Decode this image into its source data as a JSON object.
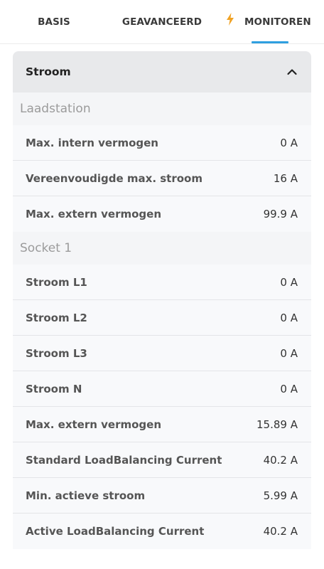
{
  "tabs": [
    {
      "label": "BASIS"
    },
    {
      "label": "GEAVANCEERD"
    },
    {
      "label": "MONITOREN",
      "icon": "lightning-bolt-icon",
      "icon_color": "#f0a224"
    }
  ],
  "accent_color": "#2f9fe0",
  "section": {
    "title": "Stroom",
    "expanded": true
  },
  "groups": [
    {
      "title": "Laadstation",
      "rows": [
        {
          "label": "Max. intern vermogen",
          "value": "0 A"
        },
        {
          "label": "Vereenvoudigde max. stroom",
          "value": "16 A"
        },
        {
          "label": "Max. extern vermogen",
          "value": "99.9 A"
        }
      ]
    },
    {
      "title": "Socket 1",
      "rows": [
        {
          "label": "Stroom L1",
          "value": "0 A"
        },
        {
          "label": "Stroom L2",
          "value": "0 A"
        },
        {
          "label": "Stroom L3",
          "value": "0 A"
        },
        {
          "label": "Stroom N",
          "value": "0 A"
        },
        {
          "label": "Max. extern vermogen",
          "value": "15.89 A"
        },
        {
          "label": "Standard LoadBalancing Current",
          "value": "40.2 A"
        },
        {
          "label": "Min. actieve stroom",
          "value": "5.99 A"
        },
        {
          "label": "Active LoadBalancing Current",
          "value": "40.2 A"
        }
      ]
    }
  ]
}
